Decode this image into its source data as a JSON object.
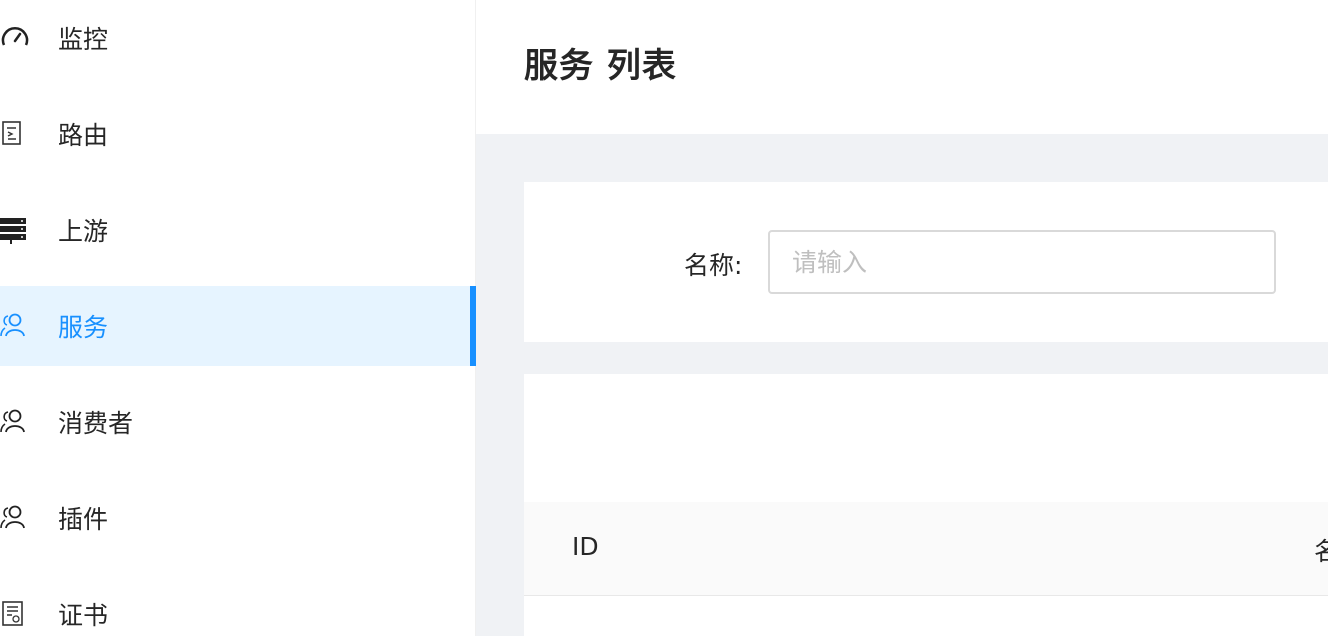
{
  "sidebar": {
    "items": [
      {
        "label": "监控",
        "icon": "dashboard-gauge-icon",
        "selected": false
      },
      {
        "label": "路由",
        "icon": "route-document-icon",
        "selected": false
      },
      {
        "label": "上游",
        "icon": "server-stack-icon",
        "selected": false
      },
      {
        "label": "服务",
        "icon": "users-icon",
        "selected": true
      },
      {
        "label": "消费者",
        "icon": "users-icon",
        "selected": false
      },
      {
        "label": "插件",
        "icon": "users-icon",
        "selected": false
      },
      {
        "label": "证书",
        "icon": "certificate-icon",
        "selected": false
      }
    ]
  },
  "page": {
    "title": "服务 列表"
  },
  "search": {
    "name_label": "名称:",
    "name_placeholder": "请输入"
  },
  "table": {
    "columns": [
      "ID",
      "名"
    ]
  },
  "colors": {
    "accent": "#1890ff",
    "selected_bg": "#e6f4ff",
    "content_bg": "#f0f2f5"
  }
}
